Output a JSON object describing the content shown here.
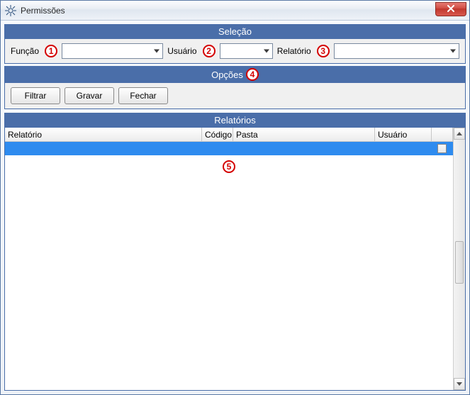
{
  "window": {
    "title": "Permissões"
  },
  "sections": {
    "selecao": {
      "title": "Seleção",
      "funcao_label": "Função",
      "usuario_label": "Usuário",
      "relatorio_label": "Relatório"
    },
    "opcoes": {
      "title": "Opções",
      "filtrar": "Filtrar",
      "gravar": "Gravar",
      "fechar": "Fechar"
    },
    "relatorios": {
      "title": "Relatórios",
      "columns": {
        "relatorio": "Relatório",
        "codigo": "Código",
        "pasta": "Pasta",
        "usuario": "Usuário"
      }
    }
  },
  "callouts": {
    "c1": "1",
    "c2": "2",
    "c3": "3",
    "c4": "4",
    "c5": "5"
  },
  "combos": {
    "funcao_value": "",
    "usuario_value": "",
    "relatorio_value": ""
  }
}
